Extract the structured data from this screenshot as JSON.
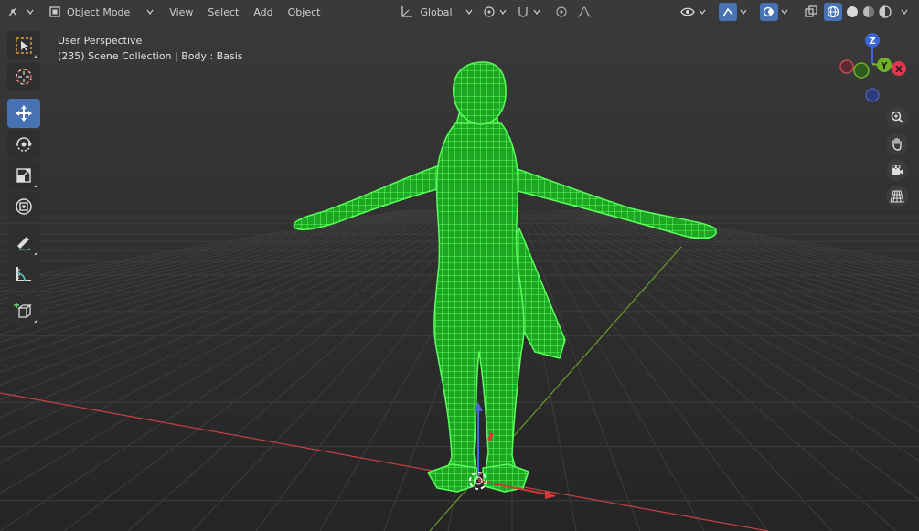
{
  "header": {
    "mode": "Object Mode",
    "menus": [
      "View",
      "Select",
      "Add",
      "Object"
    ],
    "transform_orientation": "Global"
  },
  "overlay": {
    "line1": "User Perspective",
    "line2": "(235) Scene Collection | Body : Basis"
  },
  "gizmo": {
    "z": "Z",
    "y": "Y",
    "x": "X"
  },
  "colors": {
    "mesh_wire": "#39e83a",
    "axis_x": "#c8403f",
    "axis_y": "#6a9e2a",
    "active_tool": "#4772b3",
    "gizmo_x": "#e0394d",
    "gizmo_y": "#6fb22a",
    "gizmo_z": "#3c66d8"
  },
  "tools": [
    {
      "name": "select-box",
      "icon": "select-box-icon",
      "active": false
    },
    {
      "name": "cursor",
      "icon": "cursor-icon",
      "active": false
    },
    {
      "name": "move",
      "icon": "move-icon",
      "active": true
    },
    {
      "name": "rotate",
      "icon": "rotate-icon",
      "active": false
    },
    {
      "name": "scale",
      "icon": "scale-icon",
      "active": false
    },
    {
      "name": "transform",
      "icon": "transform-icon",
      "active": false
    },
    {
      "name": "annotate",
      "icon": "annotate-icon",
      "active": false
    },
    {
      "name": "measure",
      "icon": "measure-icon",
      "active": false
    },
    {
      "name": "add-cube",
      "icon": "add-cube-icon",
      "active": false
    }
  ]
}
